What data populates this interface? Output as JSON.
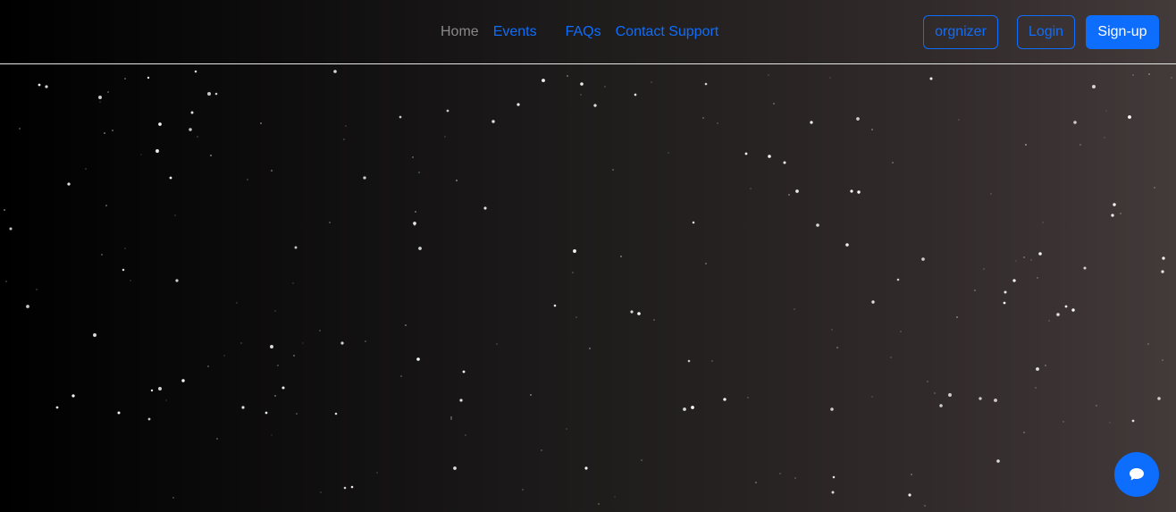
{
  "nav": {
    "links": [
      {
        "label": "Home",
        "active": true
      },
      {
        "label": "Events",
        "active": false
      },
      {
        "label": "FAQs",
        "active": false
      },
      {
        "label": "Contact Support",
        "active": false
      }
    ]
  },
  "buttons": {
    "organizer": "orgnizer",
    "login": "Login",
    "signup": "Sign-up"
  },
  "chat": {
    "icon": "chat-bubble-icon"
  },
  "colors": {
    "accent": "#0d6efd",
    "nav_inactive": "#8a8a8a",
    "background_start": "#000000",
    "background_end": "#433a3a",
    "star": "#ffffff"
  }
}
